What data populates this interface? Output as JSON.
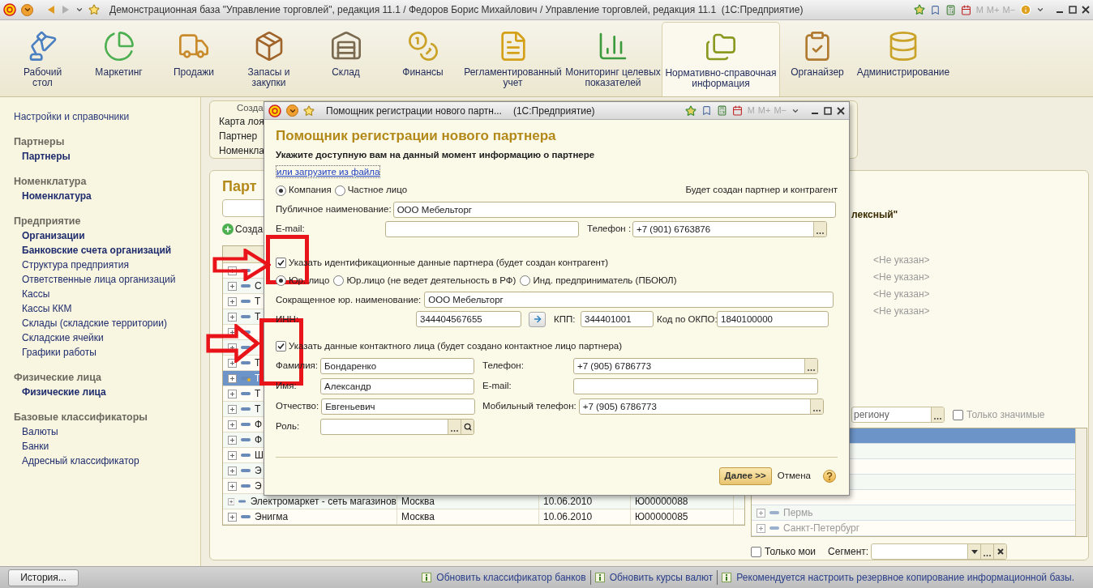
{
  "window": {
    "title": "Демонстрационная база \"Управление торговлей\", редакция 11.1 / Федоров Борис Михайлович / Управление торговлей, редакция 11.1  (1С:Предприятие)",
    "memory_buttons": [
      "M",
      "M+",
      "M−"
    ]
  },
  "sections": [
    {
      "label": "Рабочий\nстол",
      "selected": false
    },
    {
      "label": "Маркетинг",
      "selected": false
    },
    {
      "label": "Продажи",
      "selected": false
    },
    {
      "label": "Запасы и\nзакупки",
      "selected": false
    },
    {
      "label": "Склад",
      "selected": false
    },
    {
      "label": "Финансы",
      "selected": false
    },
    {
      "label": "Регламентированный\nучет",
      "selected": false
    },
    {
      "label": "Мониторинг целевых\nпоказателей",
      "selected": false
    },
    {
      "label": "Нормативно-справочная\nинформация",
      "selected": true
    },
    {
      "label": "Органайзер",
      "selected": false
    },
    {
      "label": "Администрирование",
      "selected": false
    }
  ],
  "sidebar": {
    "top_link": "Настройки и справочники",
    "groups": [
      {
        "title": "Партнеры",
        "items": [
          {
            "label": "Партнеры",
            "bold": true
          }
        ]
      },
      {
        "title": "Номенклатура",
        "items": [
          {
            "label": "Номенклатура",
            "bold": true
          }
        ]
      },
      {
        "title": "Предприятие",
        "items": [
          {
            "label": "Организации",
            "bold": true
          },
          {
            "label": "Банковские счета организаций",
            "bold": true
          },
          {
            "label": "Структура предприятия",
            "bold": false
          },
          {
            "label": "Ответственные лица организаций",
            "bold": false
          },
          {
            "label": "Кассы",
            "bold": false
          },
          {
            "label": "Кассы ККМ",
            "bold": false
          },
          {
            "label": "Склады (складские территории)",
            "bold": false
          },
          {
            "label": "Складские ячейки",
            "bold": false
          },
          {
            "label": "Графики работы",
            "bold": false
          }
        ]
      },
      {
        "title": "Физические лица",
        "items": [
          {
            "label": "Физические лица",
            "bold": true
          }
        ]
      },
      {
        "title": "Базовые классификаторы",
        "items": [
          {
            "label": "Валюты",
            "bold": false
          },
          {
            "label": "Банки",
            "bold": false
          },
          {
            "label": "Адресный классификатор",
            "bold": false
          }
        ]
      }
    ]
  },
  "create_panel": {
    "title": "Созда",
    "items": [
      "Карта лоя",
      "Партнер",
      "Номенкла"
    ]
  },
  "partners": {
    "title": "Парт",
    "create_button": "Созда",
    "rows": [
      {
        "selected": false
      },
      {
        "name": "С",
        "selected": false
      },
      {
        "name": "Т",
        "selected": false
      },
      {
        "name": "Т",
        "selected": false
      },
      {
        "selected": false
      },
      {
        "selected": false
      },
      {
        "name": "Т",
        "selected": false
      },
      {
        "name": "Т",
        "selected": true
      },
      {
        "name": "Т",
        "selected": false
      },
      {
        "name": "Т",
        "selected": false
      },
      {
        "name": "Ф",
        "selected": false
      },
      {
        "name": "Ф",
        "selected": false
      },
      {
        "name": "Ш",
        "selected": false
      },
      {
        "name": "Э",
        "selected": false
      },
      {
        "name": "Э",
        "selected": false
      },
      {
        "name": "Электромаркет - сеть магазинов",
        "city": "Москва",
        "date": "10.06.2010",
        "code": "Ю00000088",
        "selected": false
      },
      {
        "name": "Энигма",
        "city": "Москва",
        "date": "10.06.2010",
        "code": "Ю00000085",
        "selected": false
      }
    ],
    "side": {
      "heading": "лексный\"",
      "values": [
        "<Не указан>",
        "<Не указан>",
        "<Не указан>",
        "<Не указан>"
      ],
      "region_filter": "региону",
      "only_significant": {
        "label": "Только значимые",
        "checked": false
      },
      "regions": [
        {
          "selected": true
        },
        {
          "selected": false
        },
        {
          "selected": false
        },
        {
          "selected": false
        },
        {
          "selected": false
        },
        {
          "name": "Пермь",
          "selected": false
        },
        {
          "name": "Санкт-Петербург",
          "selected": false
        }
      ],
      "only_mine": {
        "label": "Только мои",
        "checked": false
      },
      "segment": {
        "label": "Сегмент:"
      }
    }
  },
  "dialog": {
    "window_title": "Помощник регистрации нового партн...",
    "app": "(1С:Предприятие)",
    "memory_buttons": [
      "M",
      "M+",
      "M−"
    ],
    "title": "Помощник регистрации нового партнера",
    "subtitle": "Укажите доступную вам на данный момент информацию о партнере",
    "load_link": "или загрузите из файла",
    "partner_types": [
      {
        "label": "Компания",
        "selected": true
      },
      {
        "label": "Частное лицо",
        "selected": false
      }
    ],
    "note": "Будет создан партнер и контрагент",
    "public_name": {
      "label": "Публичное наименование:",
      "value": "ООО Мебельторг"
    },
    "email": {
      "label": "E-mail:"
    },
    "phone": {
      "label": "Телефон :",
      "value": "+7 (901) 6763876"
    },
    "ident": {
      "label": "Указать идентификационные данные партнера (будет создан контрагент)",
      "checked": true
    },
    "legal_types": [
      {
        "label": "Юр. лицо",
        "selected": true
      },
      {
        "label": "Юр.лицо (не ведет деятельность в РФ)",
        "selected": false
      },
      {
        "label": "Инд. предприниматель (ПБОЮЛ)",
        "selected": false
      }
    ],
    "short_name": {
      "label": "Сокращенное юр. наименование:",
      "value": "ООО Мебельторг"
    },
    "inn": {
      "label": "ИНН:",
      "value": "344404567655"
    },
    "kpp": {
      "label": "КПП:",
      "value": "344401001"
    },
    "okpo": {
      "label": "Код по ОКПО:",
      "value": "1840100000"
    },
    "contact": {
      "label": "Указать данные контактного лица (будет создано контактное лицо партнера)",
      "checked": true
    },
    "contact_fields": [
      {
        "label": "Фамилия:",
        "value": "Бондаренко",
        "kind": "plain"
      },
      {
        "label": "Телефон:",
        "value": "+7 (905) 6786773",
        "kind": "choice"
      },
      {
        "label": "Имя:",
        "value": "Александр",
        "kind": "plain"
      },
      {
        "label": "E-mail:",
        "kind": "plain"
      },
      {
        "label": "Отчество:",
        "value": "Евгеньевич",
        "kind": "plain"
      },
      {
        "label": "Мобильный телефон:",
        "value": "+7 (905) 6786773",
        "kind": "choice"
      },
      {
        "label": "Роль:",
        "kind": "lookup"
      }
    ],
    "next_button": "Далее >>",
    "cancel_button": "Отмена"
  },
  "status_bar": {
    "history_button": "История...",
    "notices": [
      "Обновить классификатор банков",
      "Обновить курсы валют",
      "Рекомендуется настроить резервное копирование информационной базы."
    ]
  }
}
